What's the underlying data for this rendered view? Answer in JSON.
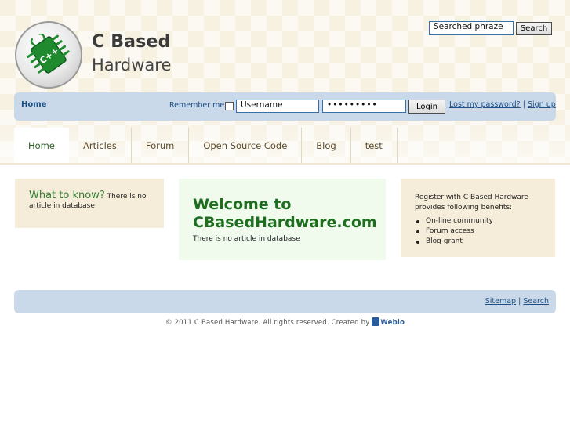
{
  "brand": {
    "name_line1": "C Based",
    "name_line2": "Hardware",
    "chip_label": "C++"
  },
  "search": {
    "value": "Searched phraze",
    "button_label": "Search"
  },
  "login_bar": {
    "home_label": "Home",
    "remember_label": "Remember me",
    "username_value": "Username",
    "password_value": "•••••••••",
    "login_button": "Login",
    "lost_password": "Lost my password?",
    "separator": "|",
    "sign_up": "Sign up"
  },
  "nav": {
    "tabs": [
      {
        "label": "Home",
        "active": true
      },
      {
        "label": "Articles"
      },
      {
        "label": "Forum"
      },
      {
        "label": "Open Source Code"
      },
      {
        "label": "Blog"
      },
      {
        "label": "test"
      }
    ]
  },
  "left_box": {
    "heading": "What to know?",
    "body": " There is no article in database"
  },
  "mid_box": {
    "welcome_line1": "Welcome to",
    "welcome_line2": "CBasedHardware.com",
    "body": "There is no article in database"
  },
  "right_box": {
    "intro": "Register with C Based Hardware provides following benefits:",
    "benefits": [
      "On-line community",
      "Forum access",
      "Blog grant"
    ]
  },
  "footer": {
    "sitemap": "Sitemap",
    "separator": "|",
    "search": "Search",
    "copyright": "© 2011 C Based Hardware. All rights reserved. Created by ",
    "creator": "Webio"
  },
  "colors": {
    "bar_blue": "#c9d9ea",
    "link_blue": "#1e4f83",
    "welcome_green": "#1f6e1f",
    "beige": "#f5ecd9"
  }
}
